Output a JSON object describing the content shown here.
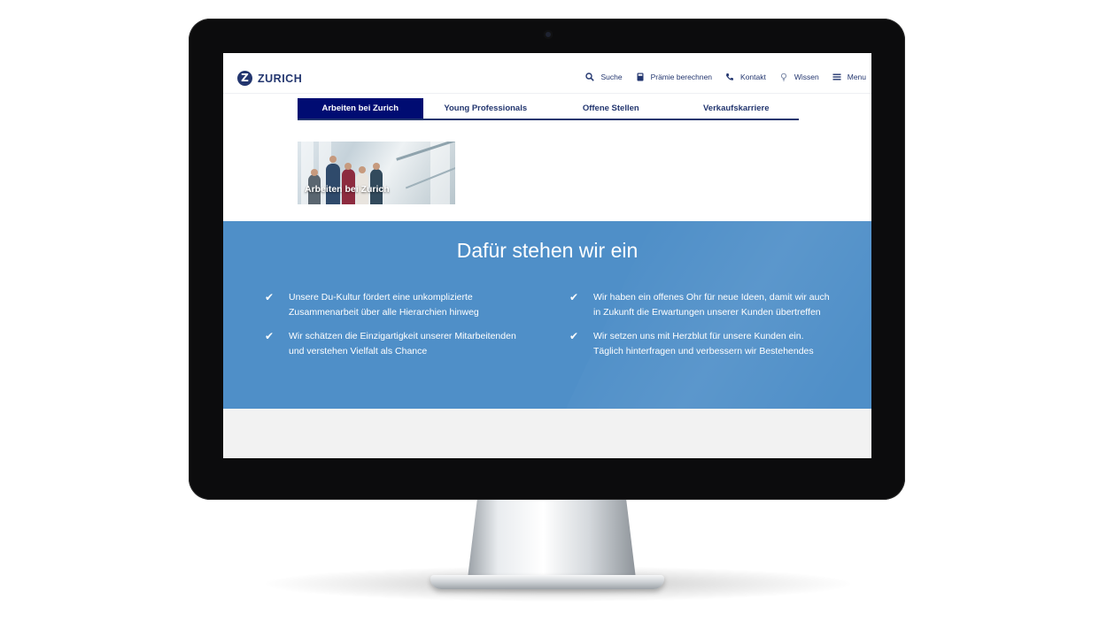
{
  "brand": {
    "logo_letter": "Z",
    "name": "ZURICH",
    "primary_color": "#23366f",
    "accent_blue": "#4f8fc8"
  },
  "header": {
    "utilities": [
      {
        "icon": "search-icon",
        "label": "Suche"
      },
      {
        "icon": "calculator-icon",
        "label": "Prämie berechnen"
      },
      {
        "icon": "phone-icon",
        "label": "Kontakt"
      },
      {
        "icon": "lightbulb-icon",
        "label": "Wissen"
      },
      {
        "icon": "hamburger-menu-icon",
        "label": "Menu"
      }
    ]
  },
  "tabs": [
    {
      "label": "Arbeiten bei Zurich",
      "active": true
    },
    {
      "label": "Young Professionals",
      "active": false
    },
    {
      "label": "Offene Stellen",
      "active": false
    },
    {
      "label": "Verkaufskarriere",
      "active": false
    }
  ],
  "hero": {
    "caption": "Arbeiten bei Zurich"
  },
  "values": {
    "title": "Dafür stehen wir ein",
    "left": [
      "Unsere Du-Kultur fördert eine unkomplizierte Zusammenarbeit über alle Hierarchien hinweg",
      "Wir schätzen die Einzigartigkeit unserer Mitarbeitenden und verstehen Vielfalt als Chance"
    ],
    "right": [
      "Wir haben ein offenes Ohr für neue Ideen, damit wir auch in Zukunft die Erwartungen unserer Kunden übertreffen",
      "Wir setzen uns mit Herzblut für unsere Kunden ein. Täglich hinterfragen und verbessern wir Bestehendes"
    ],
    "check_glyph": "✔"
  }
}
